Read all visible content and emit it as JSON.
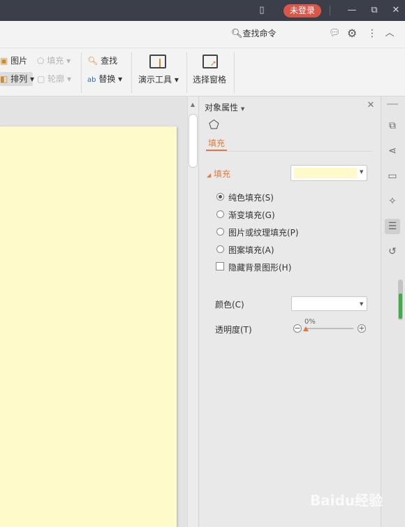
{
  "titlebar": {
    "login_label": "未登录"
  },
  "cmdbar": {
    "search_label": "查找命令"
  },
  "ribbon": {
    "picture": "图片",
    "fill": "填充",
    "arrange": "排列",
    "outline": "轮廓",
    "find": "查找",
    "replace": "替换",
    "presentation_tools": "演示工具",
    "selection_pane": "选择窗格"
  },
  "panel": {
    "title": "对象属性",
    "tab_fill": "填充",
    "section_fill": "填充",
    "fill_color": "#fffac9",
    "options": [
      {
        "label": "纯色填充(S)",
        "selected": true
      },
      {
        "label": "渐变填充(G)",
        "selected": false
      },
      {
        "label": "图片或纹理填充(P)",
        "selected": false
      },
      {
        "label": "图案填充(A)",
        "selected": false
      }
    ],
    "hide_bg_label": "隐藏背景图形(H)",
    "color_label": "颜色(C)",
    "transparency_label": "透明度(T)",
    "transparency_value": "0%",
    "transparency_fraction": 0.0,
    "color_value": "#ffffff"
  },
  "colors": {
    "titlebar": "#3b3f4a",
    "login_badge": "#d9564b",
    "accent": "#e07a3c",
    "slide": "#fffac9"
  },
  "watermark": "Baidu经验"
}
